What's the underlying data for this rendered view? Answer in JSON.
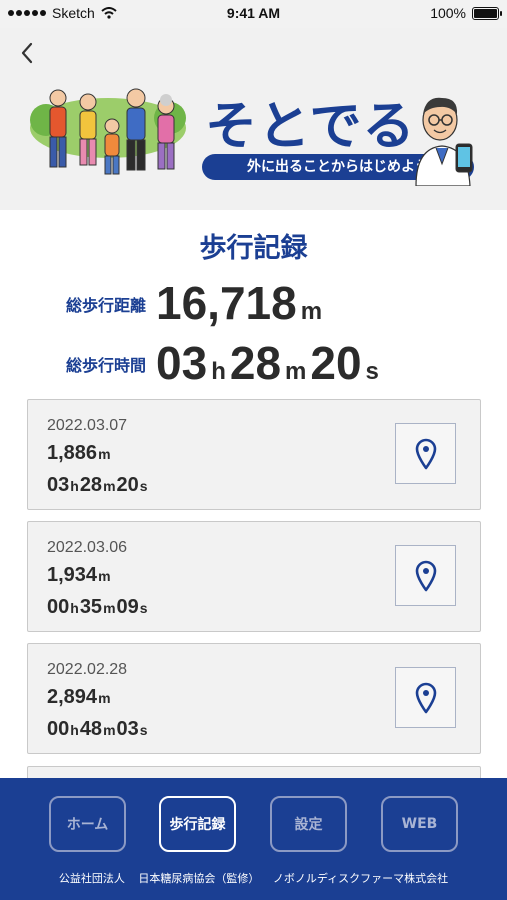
{
  "status_bar": {
    "carrier": "Sketch",
    "time": "9:41 AM",
    "battery": "100%",
    "battery_level": 1.0
  },
  "header": {
    "back_icon": "chevron-left-icon",
    "brand_title": "そとでる",
    "brand_subtitle": "外に出ることからはじめよう"
  },
  "summary": {
    "title": "歩行記録",
    "distance_label": "総歩行距離",
    "distance_value": "16,718",
    "distance_unit": "m",
    "time_label": "総歩行時間",
    "hours": "03",
    "hours_unit": "h",
    "minutes": "28",
    "minutes_unit": "m",
    "seconds": "20",
    "seconds_unit": "s"
  },
  "records": [
    {
      "date": "2022.03.07",
      "distance": "1,886",
      "distance_unit": "m",
      "h": "03",
      "m": "28",
      "s": "20"
    },
    {
      "date": "2022.03.06",
      "distance": "1,934",
      "distance_unit": "m",
      "h": "00",
      "m": "35",
      "s": "09"
    },
    {
      "date": "2022.02.28",
      "distance": "2,894",
      "distance_unit": "m",
      "h": "00",
      "m": "48",
      "s": "03"
    }
  ],
  "time_units": {
    "h": "h",
    "m": "m",
    "s": "s"
  },
  "record_icon": "map-pin-icon",
  "nav": {
    "home": "ホーム",
    "records": "歩行記録",
    "settings": "設定",
    "web": "WEB",
    "active": "records"
  },
  "footer": "公益社団法人 日本糖尿病協会（監修） ノボノルディスクファーマ株式会社",
  "colors": {
    "brand_navy": "#1b3f93",
    "header_bg": "#f1f1f1",
    "card_bg": "#f2f2f2"
  }
}
